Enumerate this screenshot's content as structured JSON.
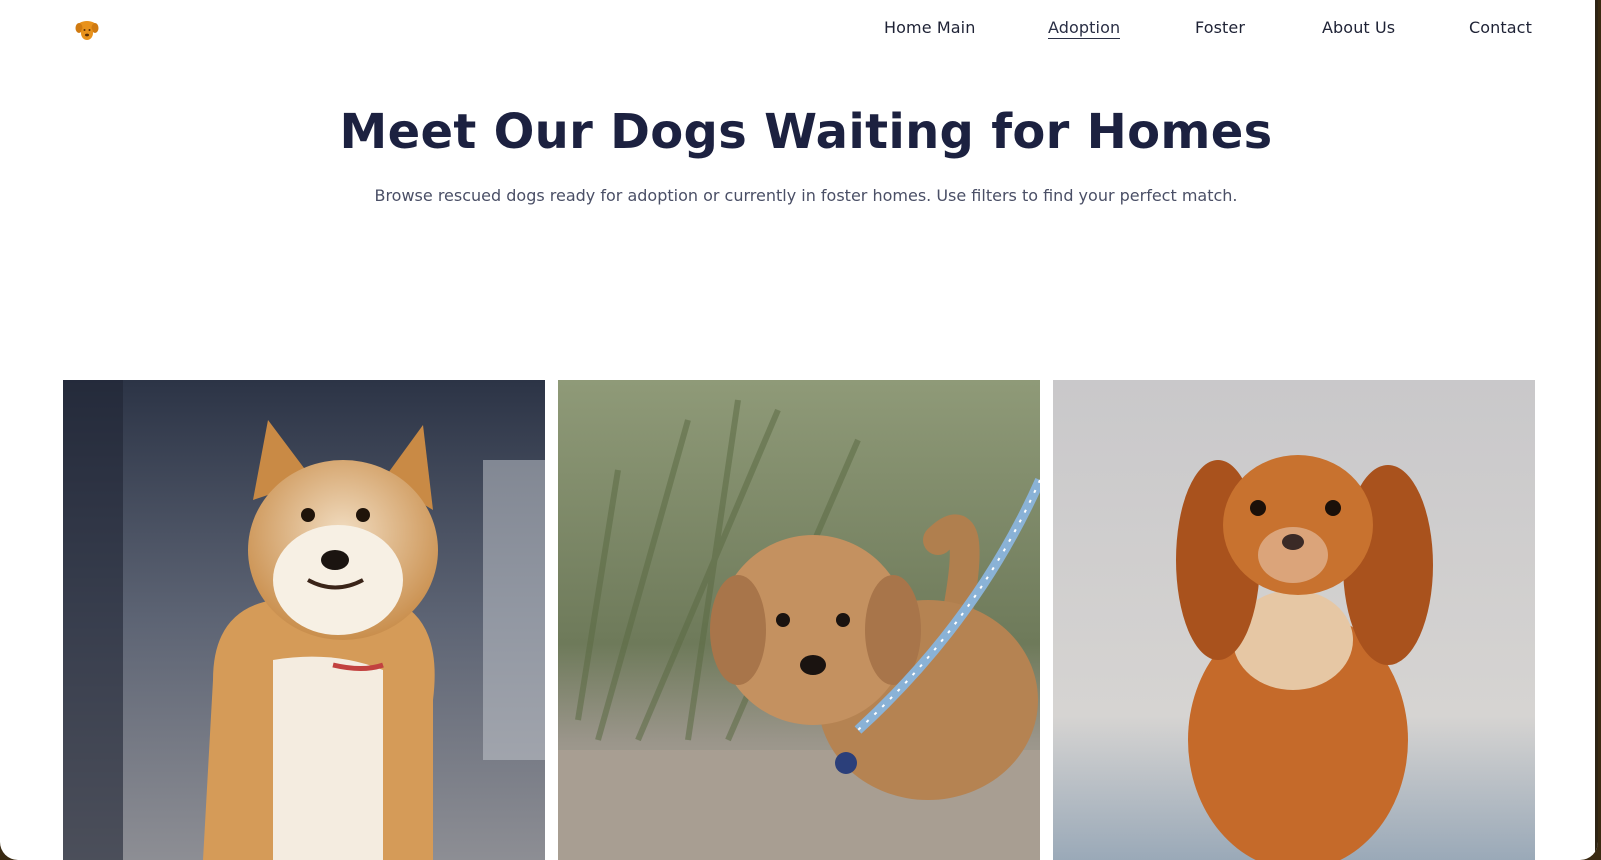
{
  "nav": {
    "logo_icon": "dog-head-icon",
    "links": [
      {
        "label": "Home Main"
      },
      {
        "label": "Adoption",
        "active": true
      },
      {
        "label": "Foster"
      },
      {
        "label": "About Us"
      },
      {
        "label": "Contact"
      }
    ]
  },
  "hero": {
    "title": "Meet Our Dogs Waiting for Homes",
    "subtitle": "Browse rescued dogs ready for adoption or currently in foster homes. Use filters to find your perfect match."
  },
  "gallery": {
    "cards": [
      {
        "image": "shiba-inu-photo"
      },
      {
        "image": "poodle-puppy-on-leash-photo"
      },
      {
        "image": "cavalier-spaniel-photo"
      }
    ]
  },
  "colors": {
    "brand_orange": "#e8921c",
    "heading_navy": "#1c2140",
    "text_gray": "#4a4f66"
  }
}
